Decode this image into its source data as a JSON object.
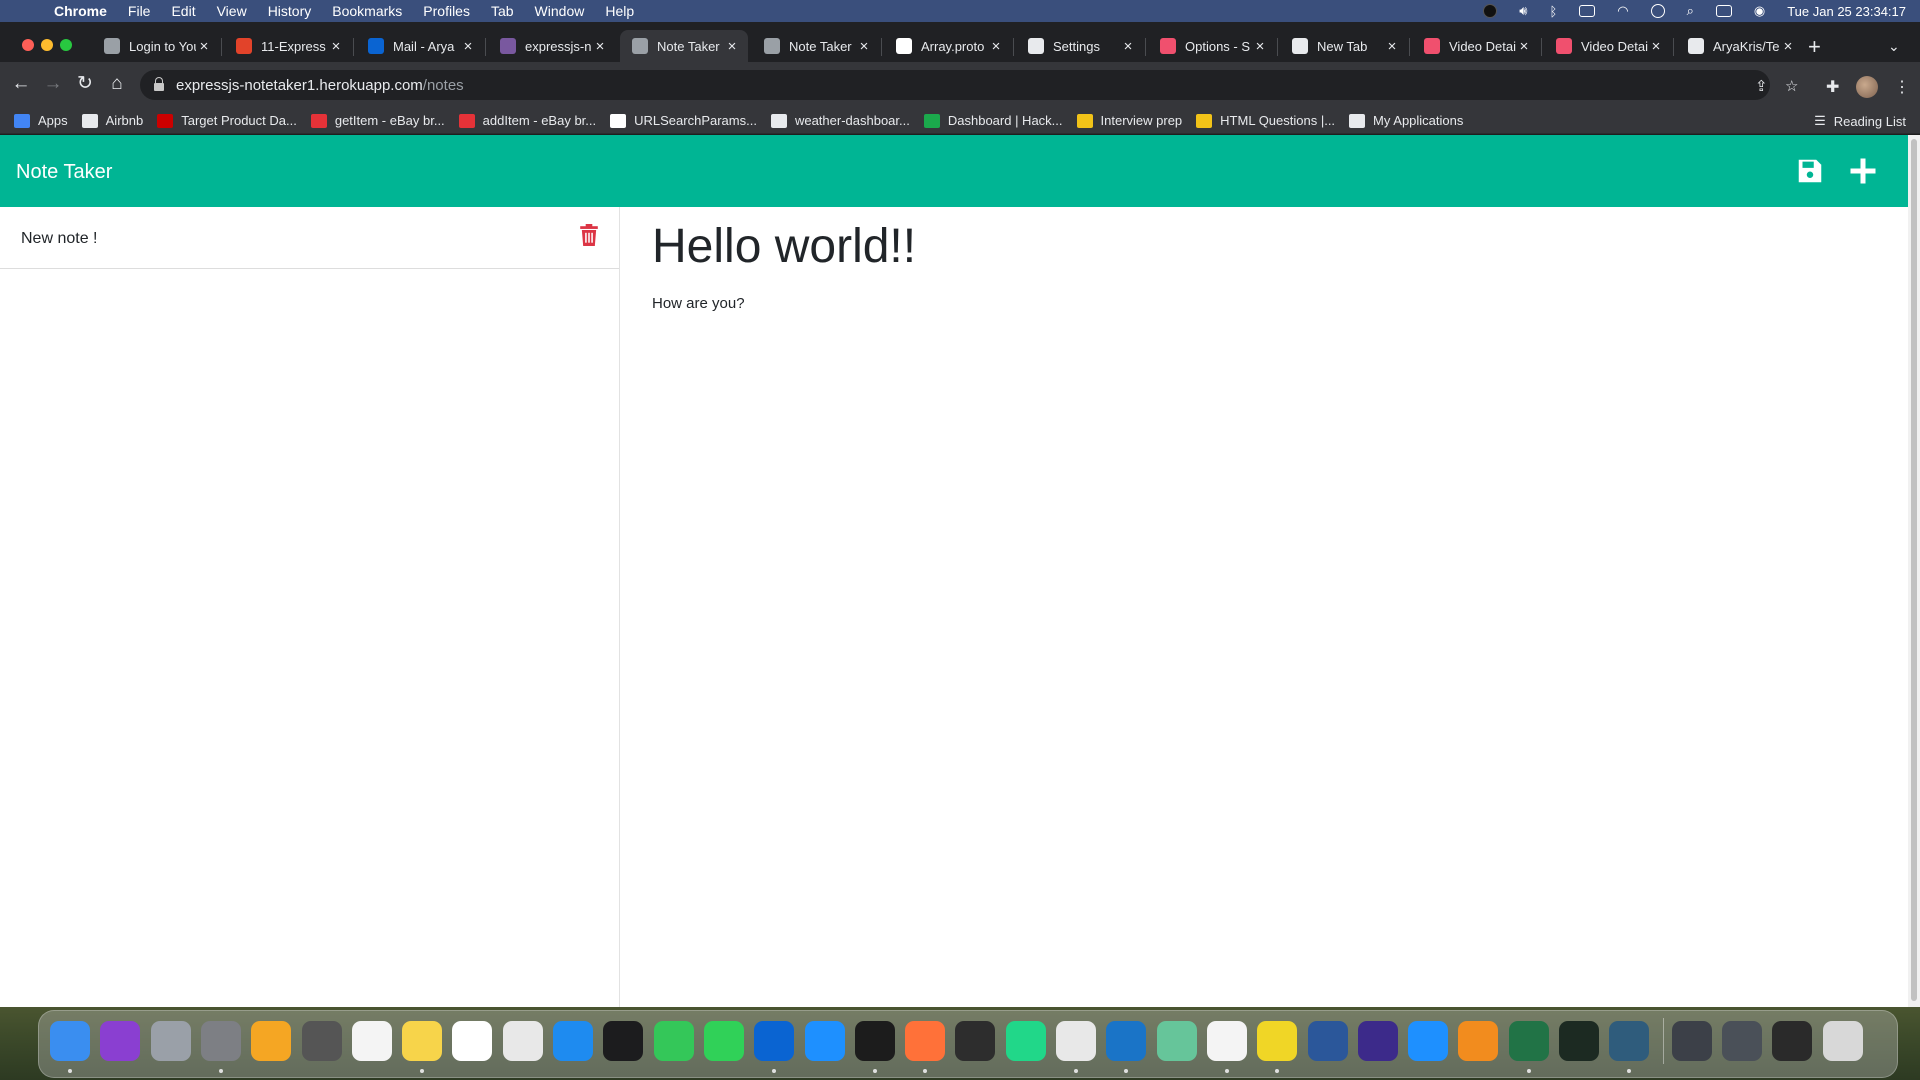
{
  "menubar": {
    "app_name": "Chrome",
    "items": [
      "File",
      "Edit",
      "View",
      "History",
      "Bookmarks",
      "Profiles",
      "Tab",
      "Window",
      "Help"
    ],
    "clock": "Tue Jan 25  23:34:17"
  },
  "tabs": [
    {
      "title": "Login to You",
      "favicon": "globe-icon",
      "color": "#9aa0a6"
    },
    {
      "title": "11-Express",
      "favicon": "gitlab-icon",
      "color": "#e2432a"
    },
    {
      "title": "Mail - Arya",
      "favicon": "outlook-icon",
      "color": "#0a64d2"
    },
    {
      "title": "expressjs-n",
      "favicon": "heroku-icon",
      "color": "#79589f"
    },
    {
      "title": "Note Taker",
      "favicon": "globe-icon",
      "color": "#9aa0a6",
      "active": true
    },
    {
      "title": "Note Taker",
      "favicon": "globe-icon",
      "color": "#9aa0a6"
    },
    {
      "title": "Array.proto",
      "favicon": "mdn-icon",
      "color": "#ffffff"
    },
    {
      "title": "Settings",
      "favicon": "gear-icon",
      "color": "#e8eaed"
    },
    {
      "title": "Options - S",
      "favicon": "video-icon",
      "color": "#f0506e"
    },
    {
      "title": "New Tab",
      "favicon": "chrome-icon",
      "color": "#e8eaed"
    },
    {
      "title": "Video Detai",
      "favicon": "video-icon",
      "color": "#f0506e"
    },
    {
      "title": "Video Detai",
      "favicon": "video-icon",
      "color": "#f0506e"
    },
    {
      "title": "AryaKris/Te",
      "favicon": "github-icon",
      "color": "#e8eaed"
    }
  ],
  "toolbar": {
    "url_host": "expressjs-notetaker1.herokuapp.com",
    "url_path": "/notes"
  },
  "bookmarks": [
    {
      "label": "Apps",
      "icon": "apps-grid-icon",
      "color": "#4285f4"
    },
    {
      "label": "Airbnb",
      "icon": "folder-icon",
      "color": "#e8eaed"
    },
    {
      "label": "Target Product Da...",
      "icon": "target-icon",
      "color": "#cc0000"
    },
    {
      "label": "getItem - eBay br...",
      "icon": "ebay-icon",
      "color": "#e53238"
    },
    {
      "label": "addItem - eBay br...",
      "icon": "ebay-icon",
      "color": "#e53238"
    },
    {
      "label": "URLSearchParams...",
      "icon": "mdn-icon",
      "color": "#ffffff"
    },
    {
      "label": "weather-dashboar...",
      "icon": "github-icon",
      "color": "#e8eaed"
    },
    {
      "label": "Dashboard | Hack...",
      "icon": "hackerrank-icon",
      "color": "#1ba94c"
    },
    {
      "label": "Interview prep",
      "icon": "bookmark-icon",
      "color": "#f2c318"
    },
    {
      "label": "HTML Questions |...",
      "icon": "bookmark-icon",
      "color": "#f2c318"
    },
    {
      "label": "My Applications",
      "icon": "globe-icon",
      "color": "#e8eaed"
    }
  ],
  "reading_list": "Reading List",
  "app": {
    "brand": "Note Taker",
    "accent": "#00b594",
    "notes": [
      {
        "title": "New note !"
      }
    ],
    "active_note": {
      "title": "Hello world!!",
      "text": "How are you?"
    }
  },
  "dock": [
    {
      "name": "finder-icon",
      "color": "#3a8ef0",
      "running": true
    },
    {
      "name": "siri-icon",
      "color": "#8a3fd1",
      "running": false
    },
    {
      "name": "launchpad-icon",
      "color": "#9aa0a8",
      "running": false
    },
    {
      "name": "system-preferences-icon",
      "color": "#7d7f84",
      "running": true
    },
    {
      "name": "photos-icon",
      "color": "#f5a623",
      "running": false
    },
    {
      "name": "calculator-icon",
      "color": "#555555",
      "running": false
    },
    {
      "name": "calendar-icon",
      "color": "#f4f4f4",
      "running": false
    },
    {
      "name": "notes-icon",
      "color": "#f7d44a",
      "running": true
    },
    {
      "name": "reminders-icon",
      "color": "#ffffff",
      "running": false
    },
    {
      "name": "textedit-icon",
      "color": "#e8e8e8",
      "running": false
    },
    {
      "name": "app-store-icon",
      "color": "#1e8bf0",
      "running": false
    },
    {
      "name": "apple-tv-icon",
      "color": "#1c1c1e",
      "running": false
    },
    {
      "name": "messages-icon",
      "color": "#34c759",
      "running": false
    },
    {
      "name": "facetime-icon",
      "color": "#30d158",
      "running": false
    },
    {
      "name": "outlook-icon",
      "color": "#0a64d2",
      "running": true
    },
    {
      "name": "safari-icon",
      "color": "#1e90ff",
      "running": false
    },
    {
      "name": "terminal-icon",
      "color": "#1c1c1c",
      "running": true
    },
    {
      "name": "firefox-icon",
      "color": "#ff7139",
      "running": true
    },
    {
      "name": "console-icon",
      "color": "#2d2d2d",
      "running": false
    },
    {
      "name": "pycharm-icon",
      "color": "#21d789",
      "running": false
    },
    {
      "name": "chrome-icon",
      "color": "#e8e8e8",
      "running": true
    },
    {
      "name": "vscode-icon",
      "color": "#1a74c7",
      "running": true
    },
    {
      "name": "atom-icon",
      "color": "#66c59a",
      "running": false
    },
    {
      "name": "slack-icon",
      "color": "#f4f4f4",
      "running": true
    },
    {
      "name": "js-icon",
      "color": "#f0d626",
      "running": true
    },
    {
      "name": "word-icon",
      "color": "#2b579a",
      "running": false
    },
    {
      "name": "eclipse-icon",
      "color": "#3c2a8a",
      "running": false
    },
    {
      "name": "mail-icon",
      "color": "#1e90ff",
      "running": false
    },
    {
      "name": "sublime-icon",
      "color": "#f28c1e",
      "running": false
    },
    {
      "name": "excel-icon",
      "color": "#217346",
      "running": true
    },
    {
      "name": "activity-monitor-icon",
      "color": "#1c2a22",
      "running": false
    },
    {
      "name": "mysql-workbench-icon",
      "color": "#2f5c7c",
      "running": true
    },
    {
      "name": "downloads-stack-icon",
      "color": "#3c4048",
      "running": false
    },
    {
      "name": "documents-stack-icon",
      "color": "#4a5058",
      "running": false
    },
    {
      "name": "keyboard-icon",
      "color": "#2a2a2a",
      "running": false
    },
    {
      "name": "trash-can-icon",
      "color": "#d8d8d8",
      "running": false
    }
  ]
}
